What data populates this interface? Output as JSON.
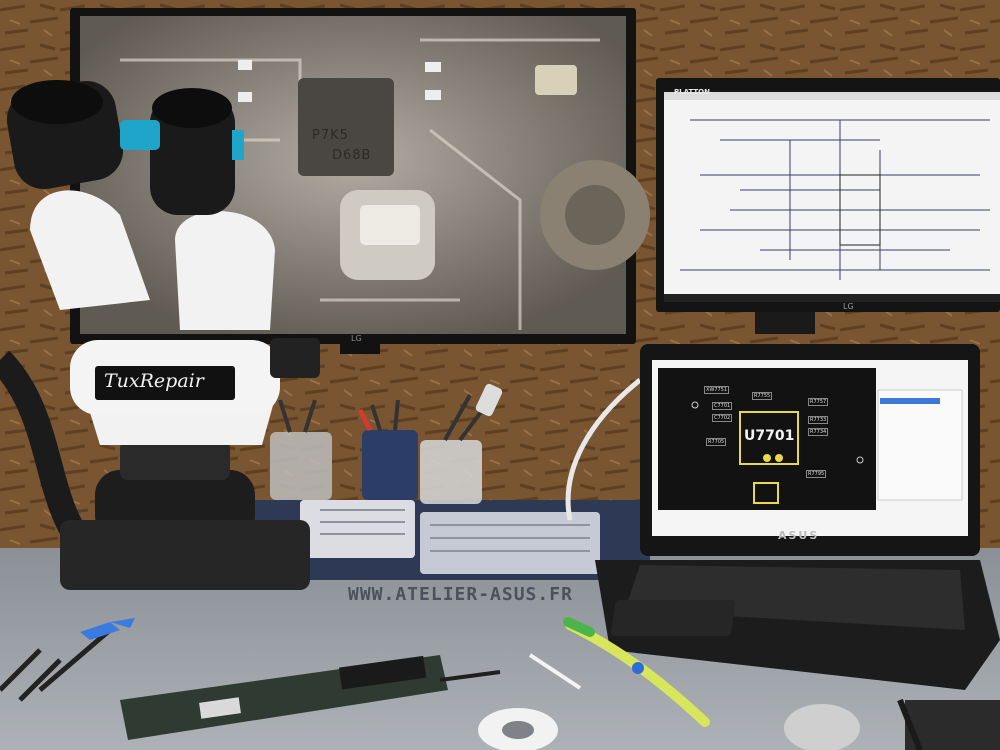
{
  "microscope": {
    "brand": "TuxRepair"
  },
  "monitor_left": {
    "chip_marking_top": "P7K5",
    "chip_marking_bottom": "D68B",
    "brand": "LG"
  },
  "monitor_right": {
    "brand": "PLATTON",
    "base_brand": "LG"
  },
  "laptop": {
    "brand": "ASUS",
    "boardview_part": "U7701",
    "boardview_labels": [
      "XW7751",
      "C7701",
      "C7702",
      "R7733",
      "R7734",
      "R7757",
      "R7755",
      "R7705",
      "R7795"
    ]
  },
  "watermark": "WWW.ATELIER-ASUS.FR",
  "colors": {
    "wall": "#7a5531",
    "desk": "#9ea2a8",
    "boardview_bg": "#121212",
    "boardview_part": "#e8d84a"
  }
}
